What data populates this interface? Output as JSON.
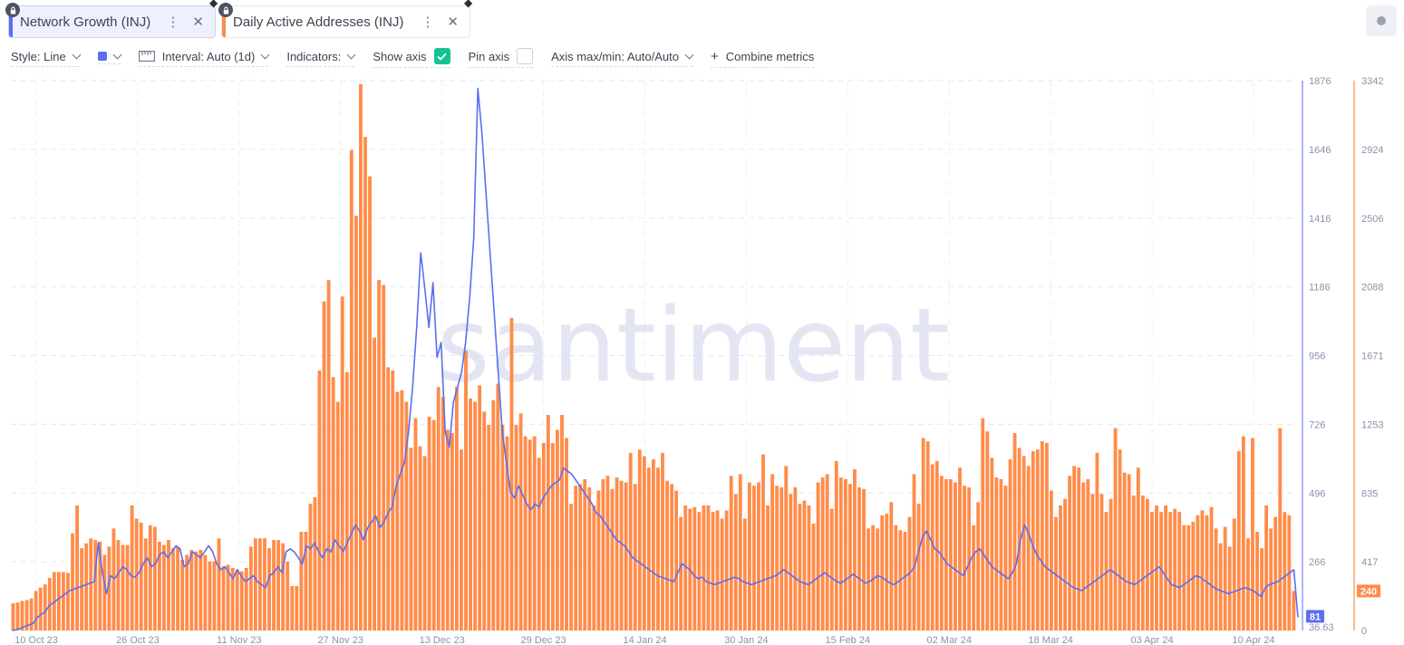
{
  "tabs": [
    {
      "label": "Network Growth (INJ)",
      "color": "#5b6ef0",
      "active": true
    },
    {
      "label": "Daily Active Addresses (INJ)",
      "color": "#ff8c4a",
      "active": false
    }
  ],
  "toolbar": {
    "style": "Style: Line",
    "interval": "Interval: Auto (1d)",
    "indicators": "Indicators:",
    "show_axis": "Show axis",
    "show_axis_checked": true,
    "pin_axis": "Pin axis",
    "pin_axis_checked": false,
    "axis_maxmin": "Axis max/min: Auto/Auto",
    "combine": "Combine metrics",
    "series_color": "#5b6ef0"
  },
  "watermark": "santiment",
  "chart_data": {
    "type": "bar+line",
    "x_tick_labels": [
      "10 Oct 23",
      "26 Oct 23",
      "11 Nov 23",
      "27 Nov 23",
      "13 Dec 23",
      "29 Dec 23",
      "14 Jan 24",
      "30 Jan 24",
      "15 Feb 24",
      "02 Mar 24",
      "18 Mar 24",
      "03 Apr 24",
      "10 Apr 24"
    ],
    "left_axis": {
      "name": "Network Growth (INJ)",
      "color": "#5b6ef0",
      "ticks": [
        "1876",
        "1646",
        "1416",
        "1186",
        "956",
        "726",
        "496",
        "266",
        "36.63"
      ],
      "range": [
        36.63,
        1876
      ],
      "last_value_label": "81"
    },
    "right_axis": {
      "name": "Daily Active Addresses (INJ)",
      "color": "#ff8c4a",
      "ticks": [
        "3342",
        "2924",
        "2506",
        "2088",
        "1671",
        "1253",
        "835",
        "417",
        "0"
      ],
      "range": [
        0,
        3342
      ],
      "last_value_label": "240"
    },
    "series": [
      {
        "name": "Daily Active Addresses (INJ)",
        "chart": "bar",
        "axis": "right",
        "values": [
          165,
          170,
          180,
          185,
          195,
          240,
          260,
          280,
          320,
          355,
          355,
          355,
          350,
          590,
          760,
          500,
          530,
          560,
          550,
          540,
          460,
          510,
          620,
          550,
          520,
          520,
          760,
          680,
          655,
          560,
          640,
          630,
          540,
          520,
          550,
          500,
          510,
          430,
          460,
          490,
          480,
          490,
          460,
          420,
          420,
          560,
          390,
          400,
          380,
          370,
          360,
          380,
          510,
          560,
          560,
          560,
          500,
          550,
          550,
          530,
          420,
          270,
          270,
          600,
          600,
          770,
          810,
          1580,
          2000,
          2130,
          1540,
          1390,
          2030,
          1570,
          2920,
          2520,
          3320,
          3000,
          2760,
          1780,
          2130,
          2100,
          1600,
          1580,
          1450,
          1460,
          1390,
          1110,
          1290,
          1120,
          1060,
          1300,
          1280,
          1480,
          1420,
          1220,
          1200,
          1480,
          1100,
          1700,
          1410,
          1390,
          1490,
          1330,
          1250,
          1400,
          1500,
          1250,
          1180,
          1900,
          1250,
          1320,
          1180,
          1160,
          1180,
          1050,
          1140,
          1310,
          1140,
          1220,
          1310,
          1170,
          770,
          880,
          890,
          920,
          870,
          760,
          850,
          920,
          940,
          860,
          930,
          910,
          900,
          1080,
          890,
          1100,
          1060,
          990,
          1040,
          990,
          1080,
          910,
          890,
          850,
          690,
          760,
          740,
          750,
          720,
          760,
          760,
          720,
          730,
          680,
          730,
          940,
          830,
          950,
          680,
          900,
          880,
          900,
          1070,
          760,
          950,
          880,
          870,
          1000,
          830,
          870,
          770,
          790,
          760,
          650,
          900,
          930,
          950,
          740,
          1030,
          930,
          920,
          890,
          980,
          870,
          860,
          620,
          640,
          620,
          700,
          710,
          780,
          640,
          610,
          600,
          690,
          950,
          770,
          1170,
          1150,
          1010,
          1030,
          940,
          920,
          920,
          900,
          990,
          880,
          870,
          640,
          780,
          1290,
          1210,
          1050,
          930,
          920,
          880,
          1040,
          1200,
          1110,
          1060,
          1000,
          1090,
          1100,
          1150,
          1140,
          850,
          690,
          760,
          800,
          940,
          1000,
          990,
          900,
          920,
          830,
          1080,
          830,
          720,
          800,
          1230,
          1100,
          960,
          950,
          820,
          990,
          820,
          800,
          720,
          760,
          720,
          760,
          720,
          740,
          720,
          640,
          640,
          660,
          700,
          730,
          700,
          750,
          620,
          530,
          630,
          510,
          680,
          1090,
          1180,
          560,
          1170,
          600,
          500,
          760,
          620,
          690,
          1230,
          720,
          700,
          240
        ]
      },
      {
        "name": "Network Growth (INJ)",
        "chart": "line",
        "axis": "left",
        "values": [
          36.63,
          40,
          45,
          50,
          55,
          60,
          80,
          90,
          100,
          120,
          130,
          140,
          150,
          160,
          170,
          175,
          180,
          185,
          190,
          195,
          200,
          330,
          230,
          160,
          220,
          210,
          230,
          250,
          240,
          220,
          215,
          230,
          260,
          280,
          250,
          260,
          290,
          300,
          280,
          300,
          320,
          310,
          250,
          260,
          300,
          290,
          280,
          300,
          320,
          300,
          260,
          240,
          250,
          230,
          210,
          240,
          220,
          200,
          210,
          220,
          200,
          190,
          180,
          220,
          230,
          250,
          230,
          300,
          310,
          300,
          280,
          260,
          320,
          310,
          330,
          300,
          280,
          310,
          300,
          340,
          320,
          300,
          330,
          360,
          390,
          370,
          340,
          380,
          400,
          420,
          380,
          400,
          430,
          450,
          520,
          560,
          600,
          700,
          850,
          1050,
          1300,
          1180,
          1050,
          1200,
          950,
          1000,
          700,
          650,
          800,
          850,
          900,
          1000,
          1150,
          1350,
          1850,
          1700,
          1500,
          1300,
          1100,
          900,
          700,
          600,
          500,
          480,
          520,
          490,
          460,
          440,
          460,
          450,
          480,
          500,
          520,
          530,
          540,
          580,
          570,
          560,
          540,
          520,
          500,
          480,
          460,
          430,
          420,
          400,
          380,
          360,
          340,
          330,
          320,
          300,
          280,
          270,
          260,
          250,
          240,
          230,
          220,
          215,
          210,
          205,
          200,
          230,
          260,
          250,
          240,
          220,
          210,
          215,
          200,
          195,
          190,
          195,
          200,
          205,
          210,
          215,
          210,
          200,
          195,
          190,
          195,
          200,
          205,
          210,
          215,
          220,
          230,
          240,
          230,
          220,
          210,
          200,
          195,
          190,
          200,
          210,
          220,
          230,
          220,
          210,
          200,
          195,
          205,
          215,
          225,
          215,
          205,
          195,
          200,
          210,
          220,
          215,
          205,
          195,
          190,
          200,
          210,
          220,
          230,
          250,
          300,
          350,
          370,
          340,
          310,
          300,
          280,
          260,
          250,
          240,
          230,
          220,
          250,
          280,
          300,
          310,
          290,
          270,
          250,
          240,
          230,
          220,
          210,
          230,
          260,
          340,
          390,
          360,
          320,
          290,
          270,
          250,
          240,
          230,
          220,
          210,
          200,
          190,
          180,
          175,
          170,
          180,
          190,
          200,
          210,
          220,
          230,
          240,
          230,
          220,
          210,
          200,
          195,
          190,
          200,
          210,
          220,
          230,
          240,
          250,
          230,
          210,
          190,
          185,
          180,
          190,
          200,
          210,
          220,
          215,
          205,
          195,
          185,
          175,
          170,
          165,
          160,
          165,
          170,
          175,
          180,
          175,
          170,
          160,
          150,
          180,
          190,
          195,
          200,
          210,
          220,
          230,
          240,
          81
        ]
      }
    ]
  }
}
